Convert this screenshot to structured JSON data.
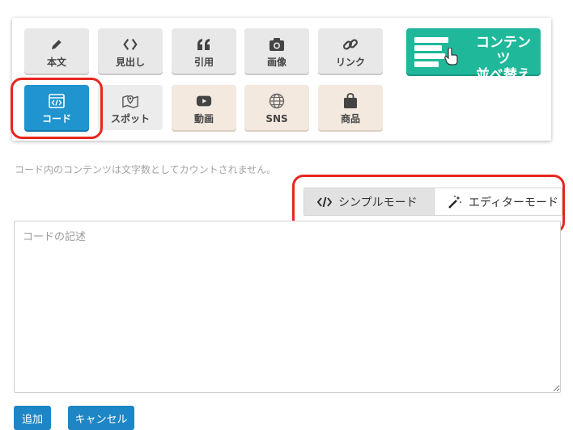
{
  "toolbar": {
    "items": [
      {
        "label": "本文",
        "icon": "pencil-icon"
      },
      {
        "label": "見出し",
        "icon": "angle-brackets-icon"
      },
      {
        "label": "引用",
        "icon": "quote-icon"
      },
      {
        "label": "画像",
        "icon": "camera-icon"
      },
      {
        "label": "リンク",
        "icon": "link-icon"
      },
      {
        "label": "コード",
        "icon": "code-window-icon",
        "active": true
      },
      {
        "label": "スポット",
        "icon": "map-pin-icon"
      },
      {
        "label": "動画",
        "icon": "play-icon"
      },
      {
        "label": "SNS",
        "icon": "globe-icon"
      },
      {
        "label": "商品",
        "icon": "shopping-bag-icon"
      }
    ],
    "reorder": {
      "line1": "コンテンツ",
      "line2": "並べ替え",
      "icon": "list-reorder-hand-icon"
    }
  },
  "editor": {
    "note": "コード内のコンテンツは文字数としてカウントされません。",
    "modes": [
      {
        "label": "シンプルモード",
        "icon": "code-icon",
        "selected": true
      },
      {
        "label": "エディターモード",
        "icon": "magic-wand-icon",
        "selected": false
      }
    ],
    "placeholder": "コードの記述",
    "value": ""
  },
  "actions": {
    "add": "追加",
    "cancel": "キャンセル"
  },
  "colors": {
    "active": "#1f94cf",
    "reorder": "#1fb89a",
    "highlight": "#e8261f",
    "button": "#1f86c5"
  }
}
